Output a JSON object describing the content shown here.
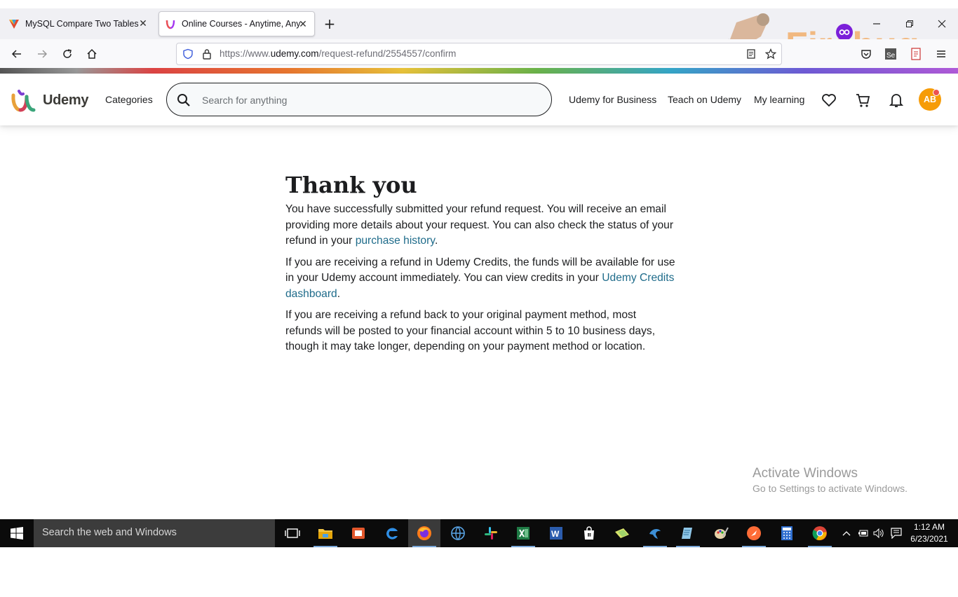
{
  "browser": {
    "tabs": [
      {
        "title": "MySQL Compare Two Tables to",
        "favicon": "vivaldi-v-icon",
        "active": false
      },
      {
        "title": "Online Courses - Anytime, Any",
        "favicon": "udemy-u-icon",
        "active": true
      }
    ],
    "url_prefix": "https://www.",
    "url_domain": "udemy.com",
    "url_path": "/request-refund/2554557/confirm",
    "firebug_label": "Firebug"
  },
  "header": {
    "logo_text": "Udemy",
    "categories": "Categories",
    "search_placeholder": "Search for anything",
    "links": {
      "business": "Udemy for Business",
      "teach": "Teach on Udemy",
      "learning": "My learning"
    },
    "avatar_initials": "AB"
  },
  "main": {
    "title": "Thank you",
    "para1_before": "You have successfully submitted your refund request. You will receive an email providing more details about your request. You can also check the status of your refund in your ",
    "para1_link": "purchase history",
    "para1_after": ".",
    "para2_before": "If you are receiving a refund in Udemy Credits, the funds will be available for use in your Udemy account immediately. You can view credits in your ",
    "para2_link": "Udemy Credits dashboard",
    "para2_after": ".",
    "para3": "If you are receiving a refund back to your original payment method, most refunds will be posted to your financial account within 5 to 10 business days, though it may take longer, depending on your payment method or location."
  },
  "watermark": {
    "title": "Activate Windows",
    "subtitle": "Go to Settings to activate Windows."
  },
  "taskbar": {
    "search_text": "Search the web and Windows",
    "time": "1:12 AM",
    "date": "6/23/2021"
  },
  "colors": {
    "udemy_link": "#1e6b8a",
    "avatar_bg": "#f69c08",
    "notification_dot": "#ec5252"
  }
}
